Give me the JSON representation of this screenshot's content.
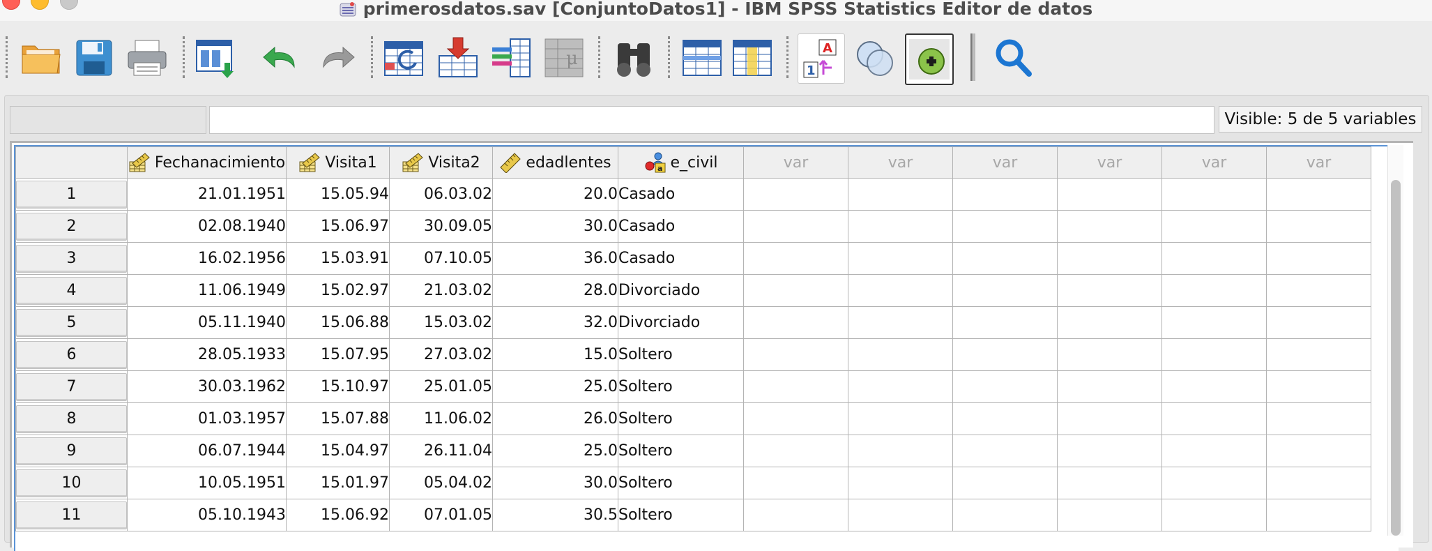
{
  "window": {
    "title": "primerosdatos.sav [ConjuntoDatos1] - IBM SPSS Statistics Editor de datos"
  },
  "toolbar": {
    "icons": [
      "open-folder-icon",
      "save-icon",
      "print-icon",
      "recall-dialog-icon",
      "undo-icon",
      "redo-icon",
      "goto-case-icon",
      "goto-variable-icon",
      "variables-icon",
      "run-descriptives-icon",
      "find-icon",
      "insert-cases-icon",
      "insert-variable-icon",
      "split-file-icon",
      "weight-cases-icon",
      "select-cases-icon",
      "value-labels-icon",
      "use-variable-sets-icon",
      "show-all-variables-icon",
      "search-icon"
    ]
  },
  "status": {
    "visible_label": "Visible: 5 de 5 variables"
  },
  "grid": {
    "columns": [
      {
        "name": "Fechanacimiento",
        "icon": "scale-date-icon"
      },
      {
        "name": "Visita1",
        "icon": "scale-date-icon"
      },
      {
        "name": "Visita2",
        "icon": "scale-date-icon"
      },
      {
        "name": "edadlentes",
        "icon": "scale-ruler-icon"
      },
      {
        "name": "e_civil",
        "icon": "nominal-string-icon"
      }
    ],
    "empty_column_label": "var",
    "rows": [
      {
        "n": "1",
        "fecha": "21.01.1951",
        "v1": "15.05.94",
        "v2": "06.03.02",
        "edad": "20.0",
        "civil": "Casado"
      },
      {
        "n": "2",
        "fecha": "02.08.1940",
        "v1": "15.06.97",
        "v2": "30.09.05",
        "edad": "30.0",
        "civil": "Casado"
      },
      {
        "n": "3",
        "fecha": "16.02.1956",
        "v1": "15.03.91",
        "v2": "07.10.05",
        "edad": "36.0",
        "civil": "Casado"
      },
      {
        "n": "4",
        "fecha": "11.06.1949",
        "v1": "15.02.97",
        "v2": "21.03.02",
        "edad": "28.0",
        "civil": "Divorciado"
      },
      {
        "n": "5",
        "fecha": "05.11.1940",
        "v1": "15.06.88",
        "v2": "15.03.02",
        "edad": "32.0",
        "civil": "Divorciado"
      },
      {
        "n": "6",
        "fecha": "28.05.1933",
        "v1": "15.07.95",
        "v2": "27.03.02",
        "edad": "15.0",
        "civil": "Soltero"
      },
      {
        "n": "7",
        "fecha": "30.03.1962",
        "v1": "15.10.97",
        "v2": "25.01.05",
        "edad": "25.0",
        "civil": "Soltero"
      },
      {
        "n": "8",
        "fecha": "01.03.1957",
        "v1": "15.07.88",
        "v2": "11.06.02",
        "edad": "26.0",
        "civil": "Soltero"
      },
      {
        "n": "9",
        "fecha": "06.07.1944",
        "v1": "15.04.97",
        "v2": "26.11.04",
        "edad": "25.0",
        "civil": "Soltero"
      },
      {
        "n": "10",
        "fecha": "10.05.1951",
        "v1": "15.01.97",
        "v2": "05.04.02",
        "edad": "30.0",
        "civil": "Soltero"
      },
      {
        "n": "11",
        "fecha": "05.10.1943",
        "v1": "15.06.92",
        "v2": "07.01.05",
        "edad": "30.5",
        "civil": "Soltero"
      }
    ]
  }
}
